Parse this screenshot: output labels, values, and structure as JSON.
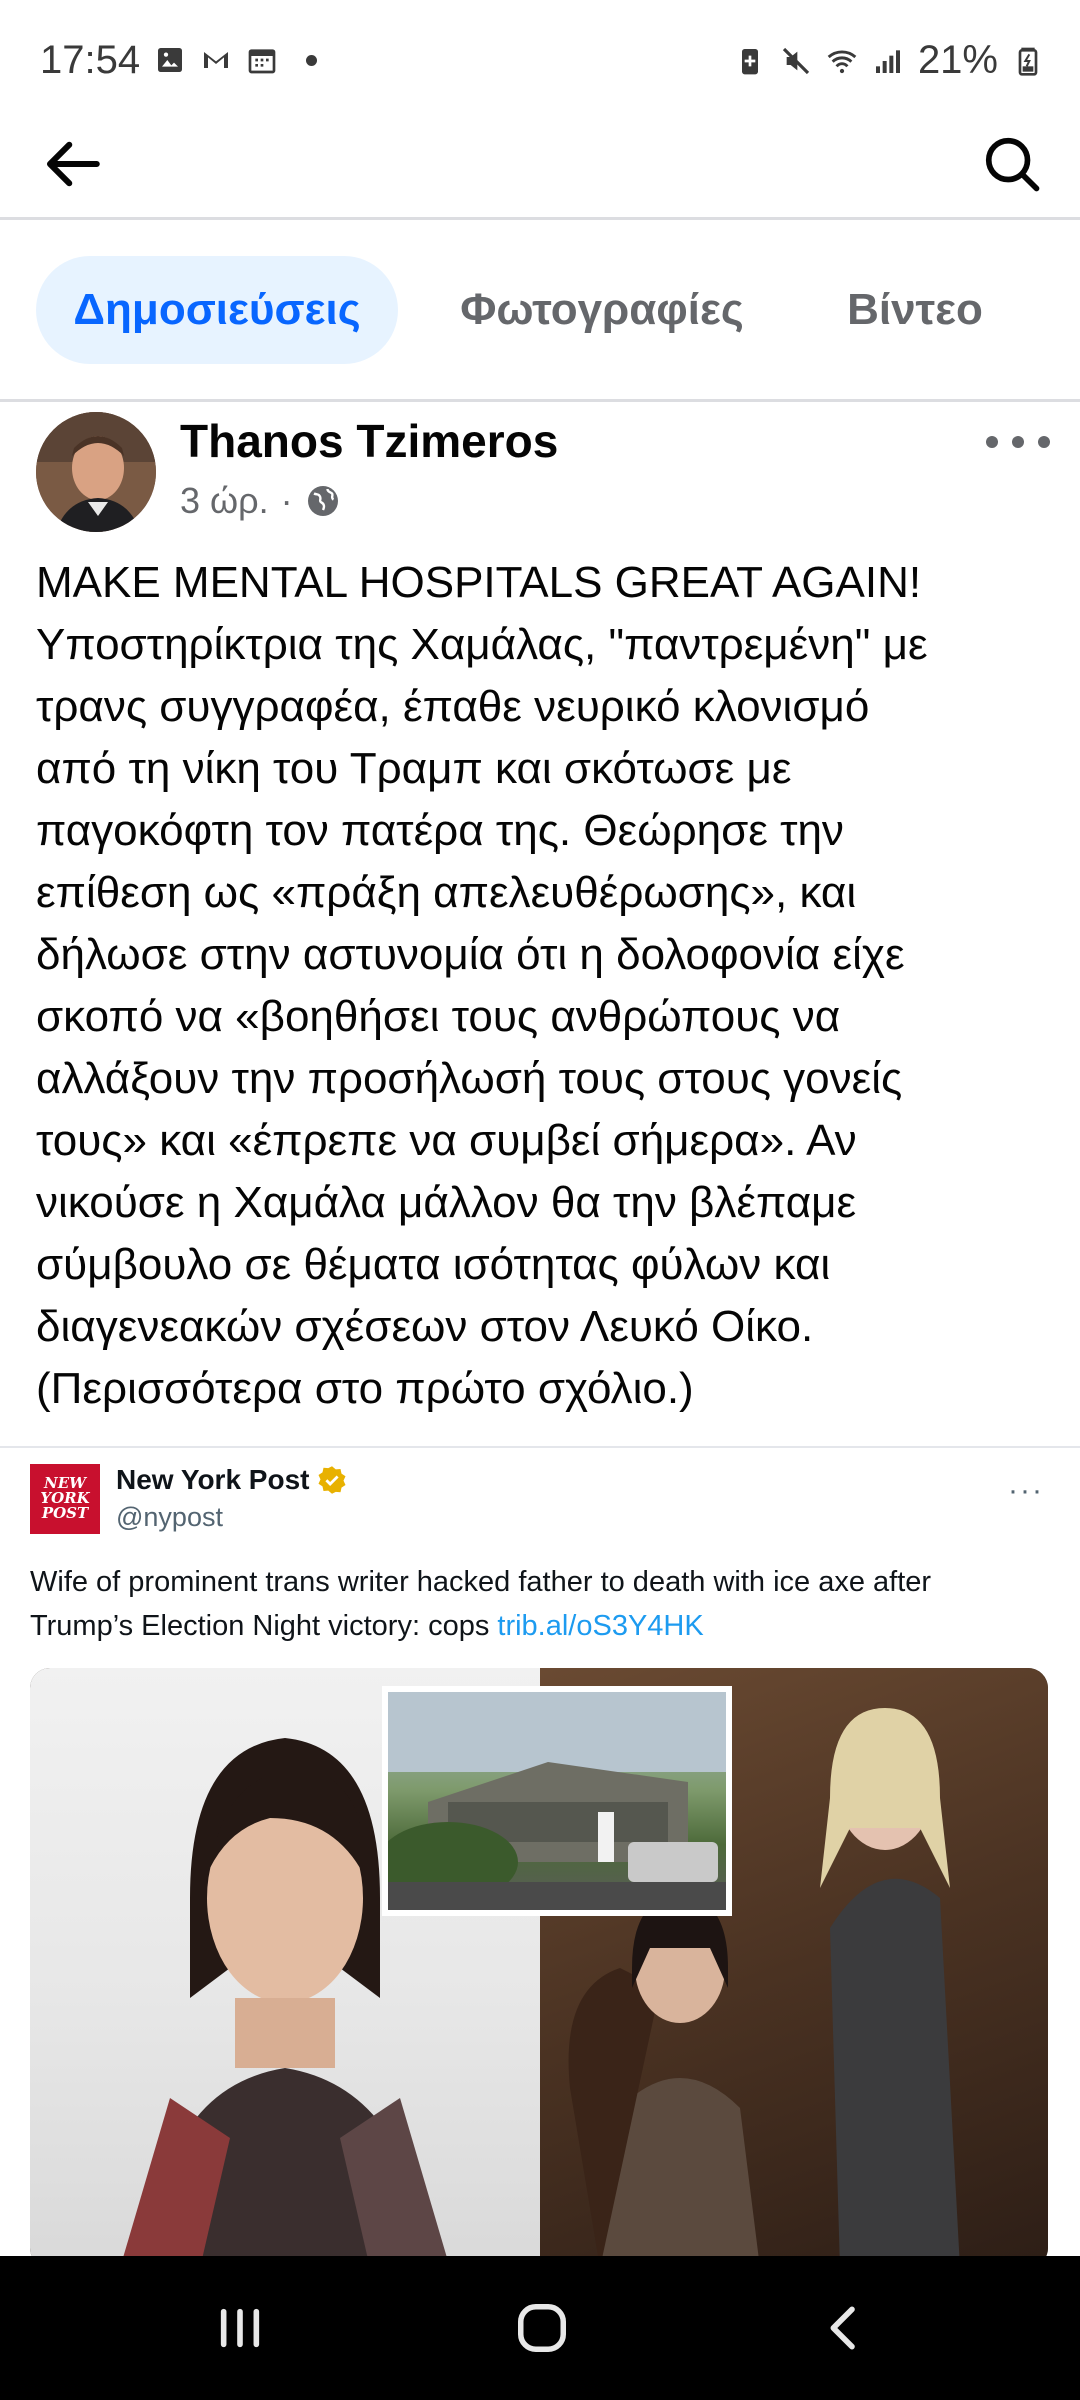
{
  "status_bar": {
    "time": "17:54",
    "battery": "21%",
    "icons": [
      "photo-icon",
      "gmail-icon",
      "calendar-icon",
      "dot",
      "battery-saver-icon",
      "mute-icon",
      "wifi-icon",
      "signal-icon",
      "battery-icon"
    ]
  },
  "header": {
    "back_icon": "arrow-left-icon",
    "search_icon": "search-icon"
  },
  "tabs": [
    {
      "label": "Δημοσιεύσεις",
      "active": true
    },
    {
      "label": "Φωτογραφίες",
      "active": false
    },
    {
      "label": "Βίντεο",
      "active": false
    }
  ],
  "post": {
    "author": "Thanos Tzimeros",
    "time": "3 ώρ.",
    "separator": "·",
    "audience_icon": "globe-icon",
    "text": "MAKE MENTAL HOSPITALS GREAT AGAIN!\nΥποστηρίκτρια της Χαμάλας, \"παντρεμένη\" με\nτρανς συγγραφέα, έπαθε νευρικό κλονισμό\nαπό τη νίκη του Τραμπ και σκότωσε με\nπαγοκόφτη τον πατέρα της. Θεώρησε την\nεπίθεση ως «πράξη απελευθέρωσης», και\nδήλωσε στην αστυνομία ότι η δολοφονία είχε\nσκοπό να «βοηθήσει τους ανθρώπους να\nαλλάξουν την προσήλωσή τους στους γονείς\nτους» και «έπρεπε να συμβεί σήμερα». Αν\nνικούσε η Χαμάλα μάλλον θα την βλέπαμε\nσύμβουλο σε θέματα ισότητας φύλων και\nδιαγενεακών σχέσεων στον Λευκό Οίκο.\n(Περισσότερα στο πρώτο σχόλιο.)"
  },
  "tweet": {
    "logo_text": "NEW YORK POST",
    "name": "New York Post",
    "handle": "@nypost",
    "more": "···",
    "text": "Wife of prominent trans writer hacked father to death with ice axe after Trump’s Election Night victory: cops ",
    "link": "trib.al/oS3Y4HK"
  },
  "colors": {
    "accent": "#0866ff",
    "tab_active_bg": "#e7f3ff",
    "secondary_text": "#65676b",
    "nypost_red": "#c8102e",
    "twitter_link": "#1d9bf0",
    "verified": "#e8b100"
  },
  "nav_bar": {
    "icons": [
      "recents-icon",
      "home-icon",
      "back-icon"
    ]
  }
}
